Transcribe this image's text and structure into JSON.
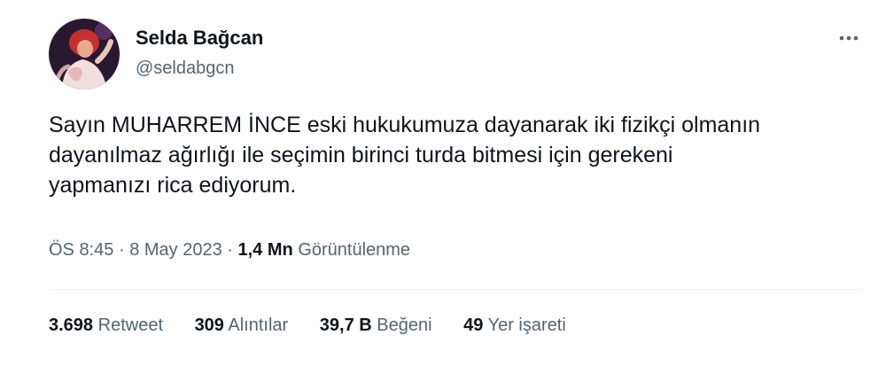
{
  "author": {
    "name": "Selda Bağcan",
    "handle": "@seldabgcn"
  },
  "tweet": {
    "text": "Sayın MUHARREM İNCE  eski hukukumuza dayanarak iki fizikçi olmanın\ndayanılmaz  ağırlığı ile seçimin birinci turda bitmesi için gerekeni\nyapmanızı rica ediyorum."
  },
  "meta": {
    "time": "ÖS 8:45",
    "separator": "·",
    "date": "8 May 2023",
    "views_count": "1,4 Mn",
    "views_label": "Görüntülenme"
  },
  "stats": {
    "retweets": {
      "count": "3.698",
      "label": "Retweet"
    },
    "quotes": {
      "count": "309",
      "label": "Alıntılar"
    },
    "likes": {
      "count": "39,7 B",
      "label": "Beğeni"
    },
    "bookmarks": {
      "count": "49",
      "label": "Yer işareti"
    }
  },
  "colors": {
    "text_primary": "#0f1419",
    "text_secondary": "#536471",
    "divider": "#eff3f4"
  },
  "icons": {
    "more": "more-horizontal-icon"
  }
}
